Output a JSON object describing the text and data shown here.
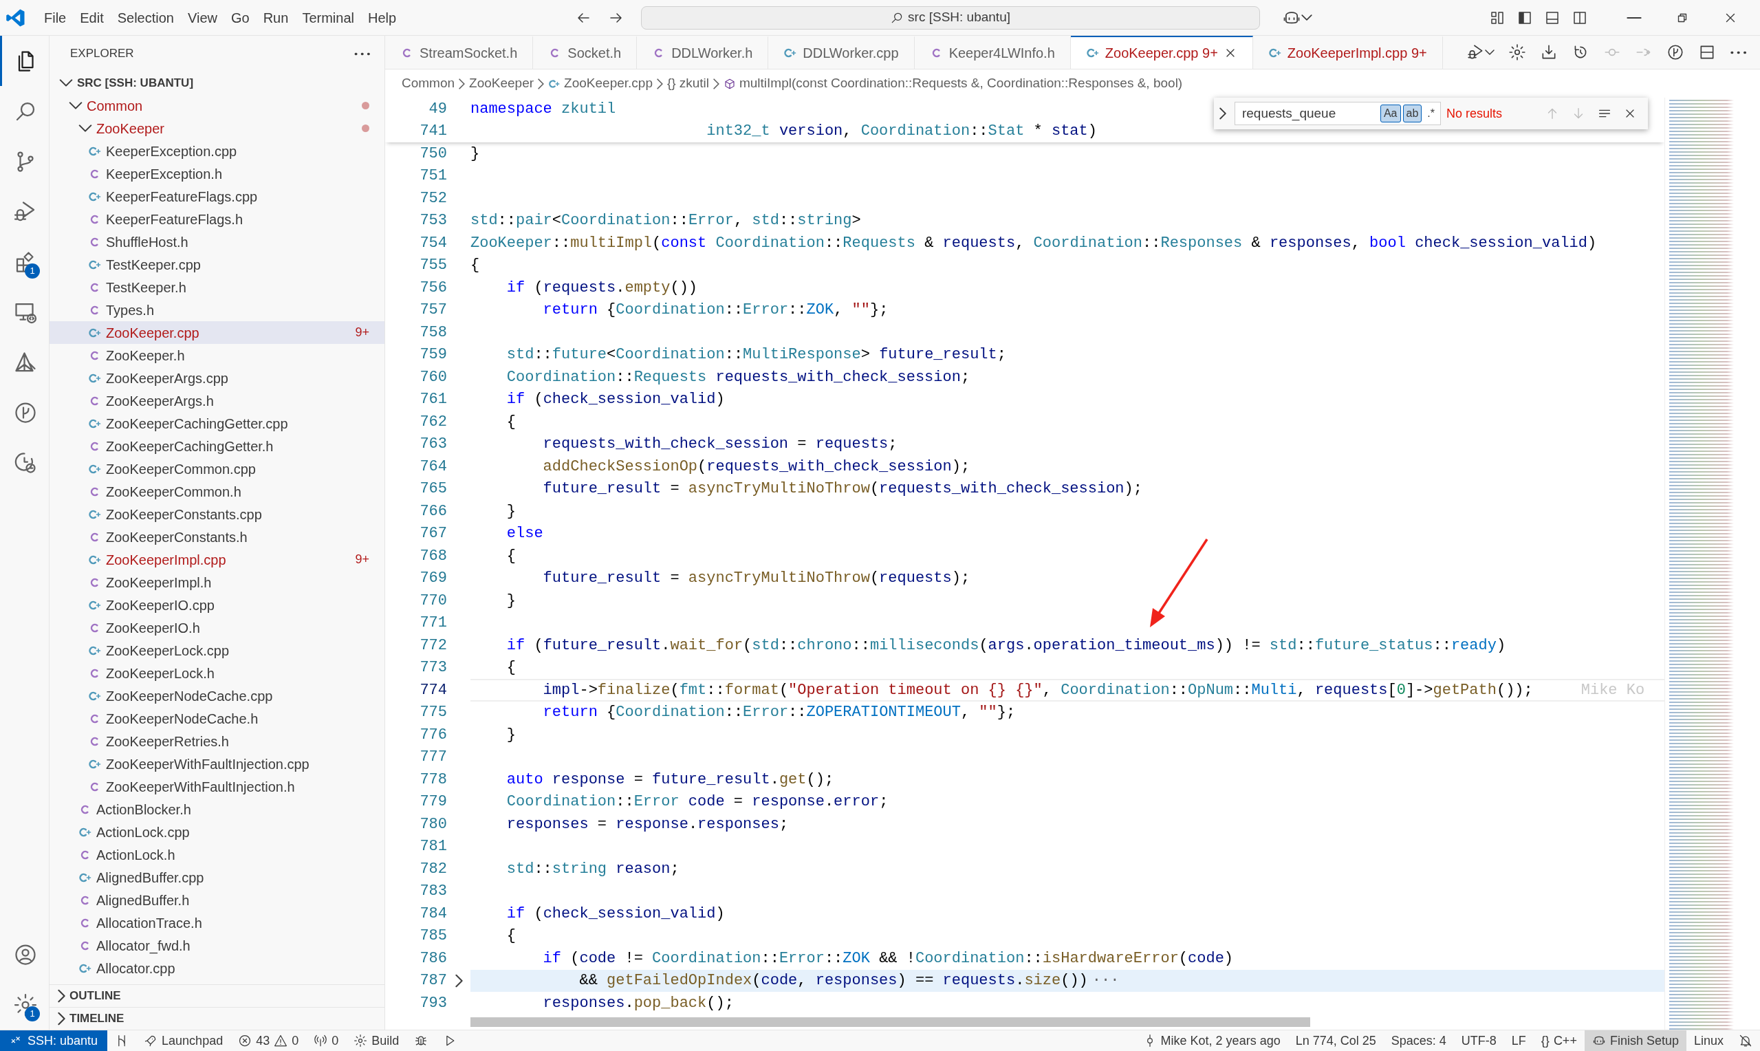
{
  "title_bar": {
    "menu": [
      "File",
      "Edit",
      "Selection",
      "View",
      "Go",
      "Run",
      "Terminal",
      "Help"
    ],
    "command_center": "src [SSH: ubantu]"
  },
  "activity_bar": {
    "items": [
      {
        "selected": true
      },
      {
        "selected": false
      },
      {
        "selected": false
      },
      {
        "selected": false
      },
      {
        "selected": false,
        "badge": "1"
      },
      {
        "selected": false
      },
      {
        "selected": false
      },
      {
        "selected": false
      },
      {
        "selected": false
      }
    ],
    "bottom": [
      {
        "selected": false
      },
      {
        "selected": false,
        "badge": "1"
      }
    ]
  },
  "sidebar": {
    "title": "EXPLORER",
    "tree": {
      "label": "SRC [SSH: UBANTU]",
      "kind": "root",
      "expanded": true,
      "selected": false,
      "error": false,
      "children": [
        {
          "label": "Common",
          "kind": "folder",
          "expanded": true,
          "selected": false,
          "error": true,
          "children": [
            {
              "label": "ZooKeeper",
              "kind": "folder",
              "expanded": true,
              "selected": false,
              "error": true,
              "children": [
                {
                  "label": "KeeperException.cpp",
                  "kind": "cpp",
                  "selected": false,
                  "error": false
                },
                {
                  "label": "KeeperException.h",
                  "kind": "h",
                  "selected": false,
                  "error": false
                },
                {
                  "label": "KeeperFeatureFlags.cpp",
                  "kind": "cpp",
                  "selected": false,
                  "error": false
                },
                {
                  "label": "KeeperFeatureFlags.h",
                  "kind": "h",
                  "selected": false,
                  "error": false
                },
                {
                  "label": "ShuffleHost.h",
                  "kind": "h",
                  "selected": false,
                  "error": false
                },
                {
                  "label": "TestKeeper.cpp",
                  "kind": "cpp",
                  "selected": false,
                  "error": false
                },
                {
                  "label": "TestKeeper.h",
                  "kind": "h",
                  "selected": false,
                  "error": false
                },
                {
                  "label": "Types.h",
                  "kind": "h",
                  "selected": false,
                  "error": false
                },
                {
                  "label": "ZooKeeper.cpp",
                  "kind": "cpp",
                  "selected": true,
                  "error": true,
                  "badge": "9+"
                },
                {
                  "label": "ZooKeeper.h",
                  "kind": "h",
                  "selected": false,
                  "error": false
                },
                {
                  "label": "ZooKeeperArgs.cpp",
                  "kind": "cpp",
                  "selected": false,
                  "error": false
                },
                {
                  "label": "ZooKeeperArgs.h",
                  "kind": "h",
                  "selected": false,
                  "error": false
                },
                {
                  "label": "ZooKeeperCachingGetter.cpp",
                  "kind": "cpp",
                  "selected": false,
                  "error": false
                },
                {
                  "label": "ZooKeeperCachingGetter.h",
                  "kind": "h",
                  "selected": false,
                  "error": false
                },
                {
                  "label": "ZooKeeperCommon.cpp",
                  "kind": "cpp",
                  "selected": false,
                  "error": false
                },
                {
                  "label": "ZooKeeperCommon.h",
                  "kind": "h",
                  "selected": false,
                  "error": false
                },
                {
                  "label": "ZooKeeperConstants.cpp",
                  "kind": "cpp",
                  "selected": false,
                  "error": false
                },
                {
                  "label": "ZooKeeperConstants.h",
                  "kind": "h",
                  "selected": false,
                  "error": false
                },
                {
                  "label": "ZooKeeperImpl.cpp",
                  "kind": "cpp",
                  "selected": false,
                  "error": true,
                  "badge": "9+"
                },
                {
                  "label": "ZooKeeperImpl.h",
                  "kind": "h",
                  "selected": false,
                  "error": false
                },
                {
                  "label": "ZooKeeperIO.cpp",
                  "kind": "cpp",
                  "selected": false,
                  "error": false
                },
                {
                  "label": "ZooKeeperIO.h",
                  "kind": "h",
                  "selected": false,
                  "error": false
                },
                {
                  "label": "ZooKeeperLock.cpp",
                  "kind": "cpp",
                  "selected": false,
                  "error": false
                },
                {
                  "label": "ZooKeeperLock.h",
                  "kind": "h",
                  "selected": false,
                  "error": false
                },
                {
                  "label": "ZooKeeperNodeCache.cpp",
                  "kind": "cpp",
                  "selected": false,
                  "error": false
                },
                {
                  "label": "ZooKeeperNodeCache.h",
                  "kind": "h",
                  "selected": false,
                  "error": false
                },
                {
                  "label": "ZooKeeperRetries.h",
                  "kind": "h",
                  "selected": false,
                  "error": false
                },
                {
                  "label": "ZooKeeperWithFaultInjection.cpp",
                  "kind": "cpp",
                  "selected": false,
                  "error": false
                },
                {
                  "label": "ZooKeeperWithFaultInjection.h",
                  "kind": "h",
                  "selected": false,
                  "error": false
                }
              ]
            },
            {
              "label": "ActionBlocker.h",
              "kind": "h",
              "selected": false,
              "error": false
            },
            {
              "label": "ActionLock.cpp",
              "kind": "cpp",
              "selected": false,
              "error": false
            },
            {
              "label": "ActionLock.h",
              "kind": "h",
              "selected": false,
              "error": false
            },
            {
              "label": "AlignedBuffer.cpp",
              "kind": "cpp",
              "selected": false,
              "error": false
            },
            {
              "label": "AlignedBuffer.h",
              "kind": "h",
              "selected": false,
              "error": false
            },
            {
              "label": "AllocationTrace.h",
              "kind": "h",
              "selected": false,
              "error": false
            },
            {
              "label": "Allocator_fwd.h",
              "kind": "h",
              "selected": false,
              "error": false
            },
            {
              "label": "Allocator.cpp",
              "kind": "cpp",
              "selected": false,
              "error": false
            }
          ]
        }
      ]
    },
    "sections": [
      {
        "label": "OUTLINE",
        "expanded": false
      },
      {
        "label": "TIMELINE",
        "expanded": false
      }
    ]
  },
  "tabs": [
    {
      "label": "StreamSocket.h",
      "kind": "h",
      "selected": false,
      "error": false
    },
    {
      "label": "Socket.h",
      "kind": "h",
      "selected": false,
      "error": false
    },
    {
      "label": "DDLWorker.h",
      "kind": "h",
      "selected": false,
      "error": false
    },
    {
      "label": "DDLWorker.cpp",
      "kind": "cpp",
      "selected": false,
      "error": false
    },
    {
      "label": "Keeper4LWInfo.h",
      "kind": "h",
      "selected": false,
      "error": false
    },
    {
      "label": "ZooKeeper.cpp",
      "kind": "cpp",
      "selected": true,
      "error": true,
      "badge": "9+"
    },
    {
      "label": "ZooKeeperImpl.cpp",
      "kind": "cpp",
      "selected": false,
      "error": true,
      "badge": "9+"
    }
  ],
  "breadcrumbs": [
    {
      "label": "Common",
      "kind": "folder"
    },
    {
      "label": "ZooKeeper",
      "kind": "folder"
    },
    {
      "label": "ZooKeeper.cpp",
      "kind": "cpp"
    },
    {
      "label": "zkutil",
      "kind": "namespace",
      "glyph": "{}"
    },
    {
      "label": "multiImpl(const Coordination::Requests &, Coordination::Responses &, bool)",
      "kind": "method"
    }
  ],
  "find": {
    "expanded": false,
    "value": "requests_queue",
    "options": [
      {
        "label": "Aa",
        "on": true
      },
      {
        "label": "ab",
        "on": true
      },
      {
        "label": ".*",
        "on": false
      }
    ],
    "result": "No results"
  },
  "sticky_lines": [
    {
      "number": "49",
      "tokens": [
        {
          "kind": "keyword",
          "text": "namespace "
        },
        {
          "kind": "type",
          "text": "zkutil"
        }
      ]
    },
    {
      "number": "741",
      "tokens": [
        {
          "kind": "type",
          "text": "                          int32_t "
        },
        {
          "kind": "variable",
          "text": "version"
        },
        {
          "kind": "plain",
          "text": ", "
        },
        {
          "kind": "type",
          "text": "Coordination"
        },
        {
          "kind": "plain",
          "text": "::"
        },
        {
          "kind": "type",
          "text": "Stat"
        },
        {
          "kind": "plain",
          "text": " * "
        },
        {
          "kind": "variable",
          "text": "stat"
        },
        {
          "kind": "plain",
          "text": ")"
        }
      ]
    }
  ],
  "lines": [
    {
      "number": "750",
      "current": false,
      "folded": false,
      "tokens": [
        {
          "kind": "plain",
          "text": "}"
        }
      ]
    },
    {
      "number": "751",
      "current": false,
      "folded": false
    },
    {
      "number": "752",
      "current": false,
      "folded": false
    },
    {
      "number": "753",
      "current": false,
      "folded": false,
      "tokens": [
        {
          "kind": "type",
          "text": "std"
        },
        {
          "kind": "plain",
          "text": "::"
        },
        {
          "kind": "type",
          "text": "pair"
        },
        {
          "kind": "plain",
          "text": "<"
        },
        {
          "kind": "type",
          "text": "Coordination"
        },
        {
          "kind": "plain",
          "text": "::"
        },
        {
          "kind": "type",
          "text": "Error"
        },
        {
          "kind": "plain",
          "text": ", "
        },
        {
          "kind": "type",
          "text": "std"
        },
        {
          "kind": "plain",
          "text": "::"
        },
        {
          "kind": "type",
          "text": "string"
        },
        {
          "kind": "plain",
          "text": ">"
        }
      ]
    },
    {
      "number": "754",
      "current": false,
      "folded": false,
      "tokens": [
        {
          "kind": "type",
          "text": "ZooKeeper"
        },
        {
          "kind": "plain",
          "text": "::"
        },
        {
          "kind": "function",
          "text": "multiImpl"
        },
        {
          "kind": "plain",
          "text": "("
        },
        {
          "kind": "keyword",
          "text": "const "
        },
        {
          "kind": "type",
          "text": "Coordination"
        },
        {
          "kind": "plain",
          "text": "::"
        },
        {
          "kind": "type",
          "text": "Requests"
        },
        {
          "kind": "plain",
          "text": " & "
        },
        {
          "kind": "variable",
          "text": "requests"
        },
        {
          "kind": "plain",
          "text": ", "
        },
        {
          "kind": "type",
          "text": "Coordination"
        },
        {
          "kind": "plain",
          "text": "::"
        },
        {
          "kind": "type",
          "text": "Responses"
        },
        {
          "kind": "plain",
          "text": " & "
        },
        {
          "kind": "variable",
          "text": "responses"
        },
        {
          "kind": "plain",
          "text": ", "
        },
        {
          "kind": "keyword",
          "text": "bool "
        },
        {
          "kind": "variable",
          "text": "check_session_valid"
        },
        {
          "kind": "plain",
          "text": ")"
        }
      ]
    },
    {
      "number": "755",
      "current": false,
      "folded": false,
      "tokens": [
        {
          "kind": "plain",
          "text": "{"
        }
      ]
    },
    {
      "number": "756",
      "current": false,
      "folded": false,
      "tokens": [
        {
          "kind": "keyword",
          "text": "    if"
        },
        {
          "kind": "plain",
          "text": " ("
        },
        {
          "kind": "variable",
          "text": "requests"
        },
        {
          "kind": "plain",
          "text": "."
        },
        {
          "kind": "function",
          "text": "empty"
        },
        {
          "kind": "plain",
          "text": "())"
        }
      ]
    },
    {
      "number": "757",
      "current": false,
      "folded": false,
      "tokens": [
        {
          "kind": "keyword",
          "text": "        return"
        },
        {
          "kind": "plain",
          "text": " {"
        },
        {
          "kind": "type",
          "text": "Coordination"
        },
        {
          "kind": "plain",
          "text": "::"
        },
        {
          "kind": "type",
          "text": "Error"
        },
        {
          "kind": "plain",
          "text": "::"
        },
        {
          "kind": "constant",
          "text": "ZOK"
        },
        {
          "kind": "plain",
          "text": ", "
        },
        {
          "kind": "string",
          "text": "\"\""
        },
        {
          "kind": "plain",
          "text": "};"
        }
      ]
    },
    {
      "number": "758",
      "current": false,
      "folded": false
    },
    {
      "number": "759",
      "current": false,
      "folded": false,
      "tokens": [
        {
          "kind": "type",
          "text": "    std"
        },
        {
          "kind": "plain",
          "text": "::"
        },
        {
          "kind": "type",
          "text": "future"
        },
        {
          "kind": "plain",
          "text": "<"
        },
        {
          "kind": "type",
          "text": "Coordination"
        },
        {
          "kind": "plain",
          "text": "::"
        },
        {
          "kind": "type",
          "text": "MultiResponse"
        },
        {
          "kind": "plain",
          "text": "> "
        },
        {
          "kind": "variable",
          "text": "future_result"
        },
        {
          "kind": "plain",
          "text": ";"
        }
      ]
    },
    {
      "number": "760",
      "current": false,
      "folded": false,
      "tokens": [
        {
          "kind": "type",
          "text": "    Coordination"
        },
        {
          "kind": "plain",
          "text": "::"
        },
        {
          "kind": "type",
          "text": "Requests "
        },
        {
          "kind": "variable",
          "text": "requests_with_check_session"
        },
        {
          "kind": "plain",
          "text": ";"
        }
      ]
    },
    {
      "number": "761",
      "current": false,
      "folded": false,
      "tokens": [
        {
          "kind": "keyword",
          "text": "    if"
        },
        {
          "kind": "plain",
          "text": " ("
        },
        {
          "kind": "variable",
          "text": "check_session_valid"
        },
        {
          "kind": "plain",
          "text": ")"
        }
      ]
    },
    {
      "number": "762",
      "current": false,
      "folded": false,
      "tokens": [
        {
          "kind": "plain",
          "text": "    {"
        }
      ]
    },
    {
      "number": "763",
      "current": false,
      "folded": false,
      "tokens": [
        {
          "kind": "variable",
          "text": "        requests_with_check_session"
        },
        {
          "kind": "plain",
          "text": " = "
        },
        {
          "kind": "variable",
          "text": "requests"
        },
        {
          "kind": "plain",
          "text": ";"
        }
      ]
    },
    {
      "number": "764",
      "current": false,
      "folded": false,
      "tokens": [
        {
          "kind": "function",
          "text": "        addCheckSessionOp"
        },
        {
          "kind": "plain",
          "text": "("
        },
        {
          "kind": "variable",
          "text": "requests_with_check_session"
        },
        {
          "kind": "plain",
          "text": ");"
        }
      ]
    },
    {
      "number": "765",
      "current": false,
      "folded": false,
      "tokens": [
        {
          "kind": "variable",
          "text": "        future_result"
        },
        {
          "kind": "plain",
          "text": " = "
        },
        {
          "kind": "function",
          "text": "asyncTryMultiNoThrow"
        },
        {
          "kind": "plain",
          "text": "("
        },
        {
          "kind": "variable",
          "text": "requests_with_check_session"
        },
        {
          "kind": "plain",
          "text": ");"
        }
      ]
    },
    {
      "number": "766",
      "current": false,
      "folded": false,
      "tokens": [
        {
          "kind": "plain",
          "text": "    }"
        }
      ]
    },
    {
      "number": "767",
      "current": false,
      "folded": false,
      "tokens": [
        {
          "kind": "keyword",
          "text": "    else"
        }
      ]
    },
    {
      "number": "768",
      "current": false,
      "folded": false,
      "tokens": [
        {
          "kind": "plain",
          "text": "    {"
        }
      ]
    },
    {
      "number": "769",
      "current": false,
      "folded": false,
      "tokens": [
        {
          "kind": "variable",
          "text": "        future_result"
        },
        {
          "kind": "plain",
          "text": " = "
        },
        {
          "kind": "function",
          "text": "asyncTryMultiNoThrow"
        },
        {
          "kind": "plain",
          "text": "("
        },
        {
          "kind": "variable",
          "text": "requests"
        },
        {
          "kind": "plain",
          "text": ");"
        }
      ]
    },
    {
      "number": "770",
      "current": false,
      "folded": false,
      "tokens": [
        {
          "kind": "plain",
          "text": "    }"
        }
      ]
    },
    {
      "number": "771",
      "current": false,
      "folded": false
    },
    {
      "number": "772",
      "current": false,
      "folded": false,
      "tokens": [
        {
          "kind": "keyword",
          "text": "    if"
        },
        {
          "kind": "plain",
          "text": " ("
        },
        {
          "kind": "variable",
          "text": "future_result"
        },
        {
          "kind": "plain",
          "text": "."
        },
        {
          "kind": "function",
          "text": "wait_for"
        },
        {
          "kind": "plain",
          "text": "("
        },
        {
          "kind": "type",
          "text": "std"
        },
        {
          "kind": "plain",
          "text": "::"
        },
        {
          "kind": "type",
          "text": "chrono"
        },
        {
          "kind": "plain",
          "text": "::"
        },
        {
          "kind": "type",
          "text": "milliseconds"
        },
        {
          "kind": "plain",
          "text": "("
        },
        {
          "kind": "variable",
          "text": "args"
        },
        {
          "kind": "plain",
          "text": "."
        },
        {
          "kind": "variable",
          "text": "operation_timeout_ms"
        },
        {
          "kind": "plain",
          "text": ")) != "
        },
        {
          "kind": "type",
          "text": "std"
        },
        {
          "kind": "plain",
          "text": "::"
        },
        {
          "kind": "type",
          "text": "future_status"
        },
        {
          "kind": "plain",
          "text": "::"
        },
        {
          "kind": "constant",
          "text": "ready"
        },
        {
          "kind": "plain",
          "text": ")"
        }
      ]
    },
    {
      "number": "773",
      "current": false,
      "folded": false,
      "tokens": [
        {
          "kind": "plain",
          "text": "    {"
        }
      ]
    },
    {
      "number": "774",
      "current": true,
      "folded": false,
      "blame": "Mike Ko",
      "tokens": [
        {
          "kind": "variable",
          "text": "        impl"
        },
        {
          "kind": "plain",
          "text": "->"
        },
        {
          "kind": "function",
          "text": "finalize"
        },
        {
          "kind": "plain",
          "text": "("
        },
        {
          "kind": "type",
          "text": "fmt"
        },
        {
          "kind": "plain",
          "text": "::"
        },
        {
          "kind": "function",
          "text": "format"
        },
        {
          "kind": "plain",
          "text": "("
        },
        {
          "kind": "string",
          "text": "\"Operation timeout on {} {}\""
        },
        {
          "kind": "plain",
          "text": ", "
        },
        {
          "kind": "type",
          "text": "Coordination"
        },
        {
          "kind": "plain",
          "text": "::"
        },
        {
          "kind": "type",
          "text": "OpNum"
        },
        {
          "kind": "plain",
          "text": "::"
        },
        {
          "kind": "constant",
          "text": "Multi"
        },
        {
          "kind": "plain",
          "text": ", "
        },
        {
          "kind": "variable",
          "text": "requests"
        },
        {
          "kind": "plain",
          "text": "["
        },
        {
          "kind": "number",
          "text": "0"
        },
        {
          "kind": "plain",
          "text": "]->"
        },
        {
          "kind": "function",
          "text": "getPath"
        },
        {
          "kind": "plain",
          "text": "());"
        }
      ]
    },
    {
      "number": "775",
      "current": false,
      "folded": false,
      "tokens": [
        {
          "kind": "keyword",
          "text": "        return"
        },
        {
          "kind": "plain",
          "text": " {"
        },
        {
          "kind": "type",
          "text": "Coordination"
        },
        {
          "kind": "plain",
          "text": "::"
        },
        {
          "kind": "type",
          "text": "Error"
        },
        {
          "kind": "plain",
          "text": "::"
        },
        {
          "kind": "constant",
          "text": "ZOPERATIONTIMEOUT"
        },
        {
          "kind": "plain",
          "text": ", "
        },
        {
          "kind": "string",
          "text": "\"\""
        },
        {
          "kind": "plain",
          "text": "};"
        }
      ]
    },
    {
      "number": "776",
      "current": false,
      "folded": false,
      "tokens": [
        {
          "kind": "plain",
          "text": "    }"
        }
      ]
    },
    {
      "number": "777",
      "current": false,
      "folded": false
    },
    {
      "number": "778",
      "current": false,
      "folded": false,
      "tokens": [
        {
          "kind": "keyword",
          "text": "    auto "
        },
        {
          "kind": "variable",
          "text": "response"
        },
        {
          "kind": "plain",
          "text": " = "
        },
        {
          "kind": "variable",
          "text": "future_result"
        },
        {
          "kind": "plain",
          "text": "."
        },
        {
          "kind": "function",
          "text": "get"
        },
        {
          "kind": "plain",
          "text": "();"
        }
      ]
    },
    {
      "number": "779",
      "current": false,
      "folded": false,
      "tokens": [
        {
          "kind": "type",
          "text": "    Coordination"
        },
        {
          "kind": "plain",
          "text": "::"
        },
        {
          "kind": "type",
          "text": "Error "
        },
        {
          "kind": "variable",
          "text": "code"
        },
        {
          "kind": "plain",
          "text": " = "
        },
        {
          "kind": "variable",
          "text": "response"
        },
        {
          "kind": "plain",
          "text": "."
        },
        {
          "kind": "variable",
          "text": "error"
        },
        {
          "kind": "plain",
          "text": ";"
        }
      ]
    },
    {
      "number": "780",
      "current": false,
      "folded": false,
      "tokens": [
        {
          "kind": "variable",
          "text": "    responses"
        },
        {
          "kind": "plain",
          "text": " = "
        },
        {
          "kind": "variable",
          "text": "response"
        },
        {
          "kind": "plain",
          "text": "."
        },
        {
          "kind": "variable",
          "text": "responses"
        },
        {
          "kind": "plain",
          "text": ";"
        }
      ]
    },
    {
      "number": "781",
      "current": false,
      "folded": false
    },
    {
      "number": "782",
      "current": false,
      "folded": false,
      "tokens": [
        {
          "kind": "type",
          "text": "    std"
        },
        {
          "kind": "plain",
          "text": "::"
        },
        {
          "kind": "type",
          "text": "string "
        },
        {
          "kind": "variable",
          "text": "reason"
        },
        {
          "kind": "plain",
          "text": ";"
        }
      ]
    },
    {
      "number": "783",
      "current": false,
      "folded": false
    },
    {
      "number": "784",
      "current": false,
      "folded": false,
      "tokens": [
        {
          "kind": "keyword",
          "text": "    if"
        },
        {
          "kind": "plain",
          "text": " ("
        },
        {
          "kind": "variable",
          "text": "check_session_valid"
        },
        {
          "kind": "plain",
          "text": ")"
        }
      ]
    },
    {
      "number": "785",
      "current": false,
      "folded": false,
      "tokens": [
        {
          "kind": "plain",
          "text": "    {"
        }
      ]
    },
    {
      "number": "786",
      "current": false,
      "folded": false,
      "tokens": [
        {
          "kind": "keyword",
          "text": "        if"
        },
        {
          "kind": "plain",
          "text": " ("
        },
        {
          "kind": "variable",
          "text": "code"
        },
        {
          "kind": "plain",
          "text": " != "
        },
        {
          "kind": "type",
          "text": "Coordination"
        },
        {
          "kind": "plain",
          "text": "::"
        },
        {
          "kind": "type",
          "text": "Error"
        },
        {
          "kind": "plain",
          "text": "::"
        },
        {
          "kind": "constant",
          "text": "ZOK"
        },
        {
          "kind": "plain",
          "text": " && !"
        },
        {
          "kind": "type",
          "text": "Coordination"
        },
        {
          "kind": "plain",
          "text": "::"
        },
        {
          "kind": "function",
          "text": "isHardwareError"
        },
        {
          "kind": "plain",
          "text": "("
        },
        {
          "kind": "variable",
          "text": "code"
        },
        {
          "kind": "plain",
          "text": ")"
        }
      ]
    },
    {
      "number": "787",
      "current": false,
      "folded": true,
      "fold_text": "···",
      "tokens": [
        {
          "kind": "plain",
          "text": "            && "
        },
        {
          "kind": "function",
          "text": "getFailedOpIndex"
        },
        {
          "kind": "plain",
          "text": "("
        },
        {
          "kind": "variable",
          "text": "code"
        },
        {
          "kind": "plain",
          "text": ", "
        },
        {
          "kind": "variable",
          "text": "responses"
        },
        {
          "kind": "plain",
          "text": ") == "
        },
        {
          "kind": "variable",
          "text": "requests"
        },
        {
          "kind": "plain",
          "text": "."
        },
        {
          "kind": "function",
          "text": "size"
        },
        {
          "kind": "plain",
          "text": "())"
        }
      ]
    },
    {
      "number": "793",
      "current": false,
      "folded": false,
      "tokens": [
        {
          "kind": "variable",
          "text": "        responses"
        },
        {
          "kind": "plain",
          "text": "."
        },
        {
          "kind": "function",
          "text": "pop_back"
        },
        {
          "kind": "plain",
          "text": "();"
        }
      ]
    }
  ],
  "status_bar": {
    "remote": "SSH: ubantu",
    "launchpad": "Launchpad",
    "errors": "43",
    "warnings": "0",
    "ports": "0",
    "build": "Build",
    "blame": "Mike Kot, 2 years ago",
    "position": "Ln 774, Col 25",
    "spaces": "Spaces: 4",
    "encoding": "UTF-8",
    "eol": "LF",
    "language_glyph": "{}",
    "language": "C++",
    "setup": "Finish Setup",
    "os": "Linux"
  }
}
